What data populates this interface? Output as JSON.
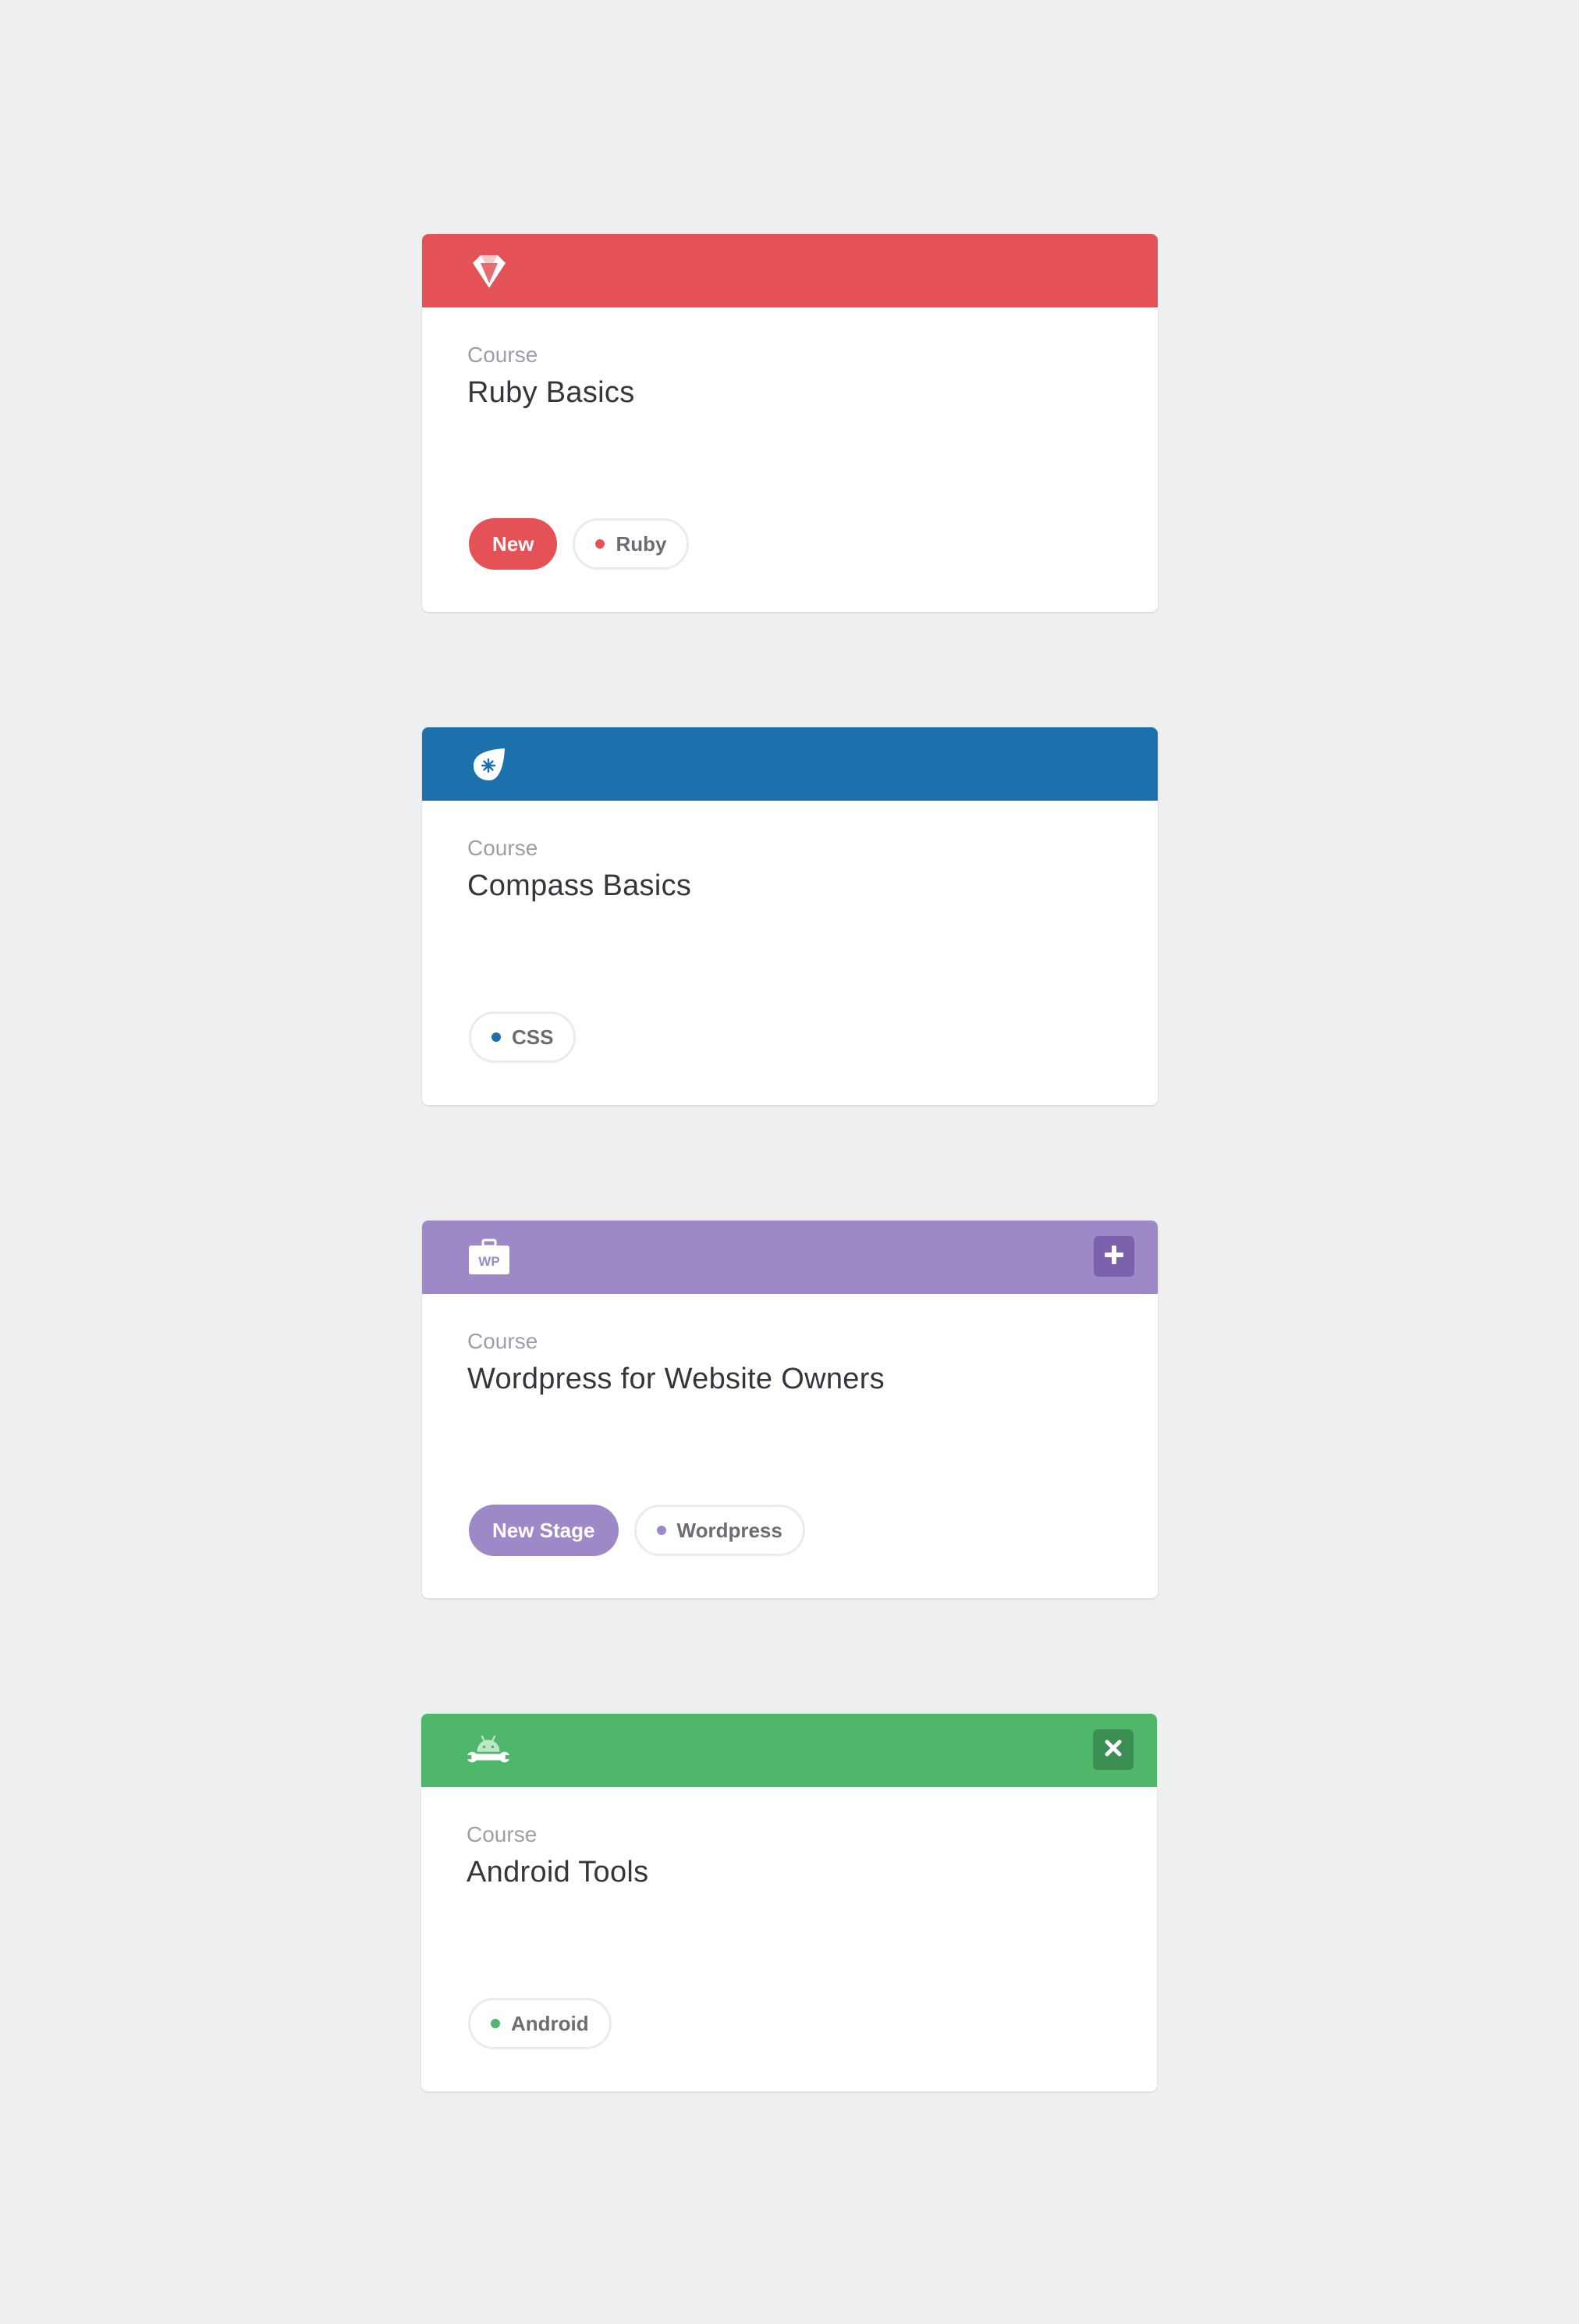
{
  "colors": {
    "page_background": "#eeeff1",
    "ruby": "#e45157",
    "css": "#1c71ad",
    "wordpress": "#9e89c8",
    "wordpress_action": "#7c62ad",
    "android": "#4fb76a",
    "android_action": "#3c8f52"
  },
  "cards": [
    {
      "header_icon": "ruby-gem-icon",
      "header_color": "#e45157",
      "label": "Course",
      "title": "Ruby Basics",
      "badge": "New",
      "tag": "Ruby",
      "tag_color": "#e45157"
    },
    {
      "header_icon": "compass-drop-icon",
      "header_color": "#1c71ad",
      "label": "Course",
      "title": "Compass Basics",
      "tag": "CSS",
      "tag_color": "#1c71ad"
    },
    {
      "header_icon": "wordpress-toolbox-icon",
      "header_icon_text": "WP",
      "header_color": "#9e89c8",
      "action_icon": "plus-icon",
      "label": "Course",
      "title": "Wordpress for Website Owners",
      "badge": "New Stage",
      "tag": "Wordpress",
      "tag_color": "#9e89c8"
    },
    {
      "header_icon": "android-wrench-icon",
      "header_color": "#4fb76a",
      "action_icon": "close-icon",
      "label": "Course",
      "title": "Android Tools",
      "tag": "Android",
      "tag_color": "#4fb76a"
    }
  ]
}
